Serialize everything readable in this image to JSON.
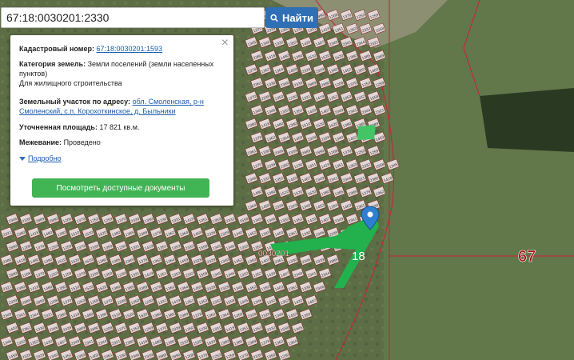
{
  "search": {
    "value": "67:18:0030201:2330",
    "button_label": "Найти"
  },
  "popup": {
    "cadastral_label": "Кадастровый номер:",
    "cadastral_value": "67:18:0030201:1593",
    "category_label": "Категория земель:",
    "category_value": "Земли поселений (земли населенных пунктов)",
    "usage_value": "Для жилищного строительства",
    "address_label": "Земельный участок по адресу:",
    "address_value": "обл. Смоленская, р-н Смоленский, с.п. Корохоткинское, д. Быльники",
    "area_label": "Уточненная площадь:",
    "area_value": "17 821 кв.м.",
    "boundary_label": "Межевание:",
    "boundary_value": "Проведено",
    "more_link": "Подробно",
    "docs_button": "Посмотреть доступные документы",
    "close_symbol": "×"
  },
  "map": {
    "quarter_label": "0030201",
    "zone_label": "18",
    "region_label": "67",
    "parcel_labels": [
      "2361",
      "1330",
      "2346",
      "2339",
      "2889",
      "2890",
      "1208",
      "1370",
      "1253",
      "1259",
      "1370",
      "2339",
      "1350",
      "1230",
      "1331",
      "1419",
      "1351",
      "1353",
      "2332",
      "1558",
      "1345",
      "1346",
      "1332",
      "1352",
      "1420",
      "1407",
      "2349",
      "2341",
      "2344",
      "2321",
      "2380",
      "1418",
      "1480",
      "1390",
      "1510",
      "1520",
      "1620",
      "1380",
      "1385",
      "2389",
      "1378",
      "1362",
      "1364",
      "1459",
      "2328",
      "2329",
      "1340",
      "1452",
      "1393",
      "1403"
    ],
    "colors": {
      "parcel_fill": "#e3d8d8",
      "parcel_border": "#8a1f1f",
      "highlight": "#22b14c",
      "marker": "#2f7fd0",
      "boundary": "#c8213a"
    }
  },
  "icons": {
    "search": "search-icon",
    "close": "close-icon",
    "marker": "map-marker-icon",
    "caret": "caret-down-icon"
  }
}
